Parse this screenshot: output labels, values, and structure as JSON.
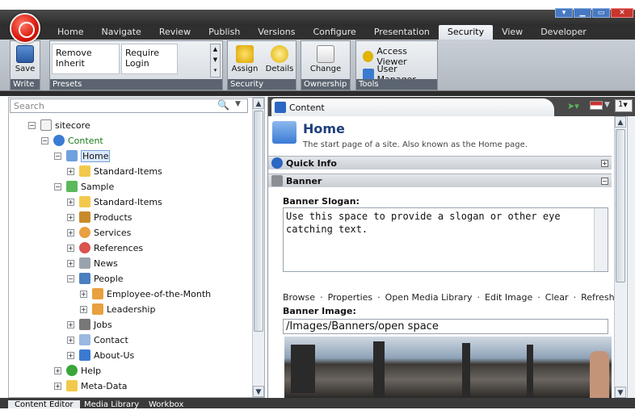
{
  "window": {
    "minimize": "▁",
    "restore": "▭",
    "close": "✕",
    "collapse": "▾"
  },
  "menu_tabs": [
    "Home",
    "Navigate",
    "Review",
    "Publish",
    "Versions",
    "Configure",
    "Presentation",
    "Security",
    "View",
    "Developer"
  ],
  "ribbon": {
    "write": {
      "save": "Save",
      "caption": "Write"
    },
    "presets": {
      "items": [
        "Remove Inherit",
        "Require Login"
      ],
      "caption": "Presets"
    },
    "security": {
      "assign": "Assign",
      "details": "Details",
      "caption": "Security"
    },
    "ownership": {
      "change": "Change",
      "caption": "Ownership"
    },
    "tools": {
      "access_viewer": "Access Viewer",
      "user_manager": "User Manager",
      "caption": "Tools"
    }
  },
  "search": {
    "placeholder": "Search"
  },
  "tree": {
    "sitecore": "sitecore",
    "content": "Content",
    "home": "Home",
    "standard_items_1": "Standard-Items",
    "sample": "Sample",
    "standard_items_2": "Standard-Items",
    "products": "Products",
    "services": "Services",
    "references": "References",
    "news": "News",
    "people": "People",
    "employee": "Employee-of-the-Month",
    "leadership": "Leadership",
    "jobs": "Jobs",
    "contact": "Contact",
    "about": "About-Us",
    "help": "Help",
    "meta": "Meta-Data"
  },
  "editor": {
    "tab": "Content",
    "lang": "1",
    "title": "Home",
    "subtitle": "The start page of a site. Also known as the Home page.",
    "quick_info": "Quick Info",
    "banner": "Banner",
    "slogan_label": "Banner Slogan:",
    "slogan_text": "Use this space to provide a slogan or other eye catching text.",
    "image_actions": [
      "Browse",
      "Properties",
      "Open Media Library",
      "Edit Image",
      "Clear",
      "Refresh"
    ],
    "image_label": "Banner Image:",
    "image_path": "/Images/Banners/open space"
  },
  "bottom_tabs": [
    "Content Editor",
    "Media Library",
    "Workbox"
  ]
}
